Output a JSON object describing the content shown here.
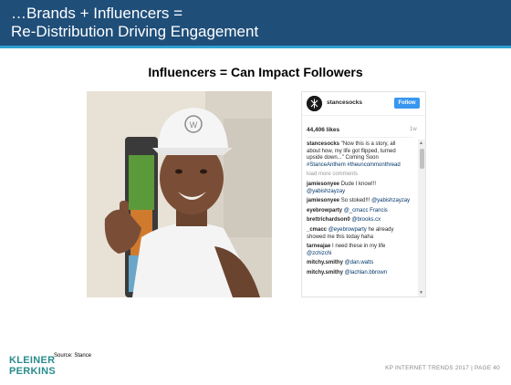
{
  "header": {
    "title_line1": "…Brands + Influencers =",
    "title_line2": "Re-Distribution Driving Engagement",
    "bg_color": "#1f4e79",
    "rule_color": "#2e9fd0"
  },
  "subtitle": "Influencers = Can Impact Followers",
  "post": {
    "username": "stancesocks",
    "follow_label": "Follow",
    "likes": "44,406 likes",
    "time": "1w",
    "caption": {
      "user": "stancesocks",
      "text": "\"Now this is a story, all about how, my life got flipped, turned upside down...\" Coming Soon",
      "tags": "#StanceAnthem #theuncommonthread"
    },
    "load_more": "load more comments",
    "comments": [
      {
        "user": "jamiesonyee",
        "text": "Dude I know!!! ",
        "mention": "@yabishzayzay"
      },
      {
        "user": "jamiesonyee",
        "text": "So stoked!!! ",
        "mention": "@yabishzayzay"
      },
      {
        "user": "eyebrowparty",
        "text": "",
        "mention": "@_cmacc Francis"
      },
      {
        "user": "brettrichardson0",
        "text": "",
        "mention": "@brooks.cx"
      },
      {
        "user": "_cmacc",
        "text": " he already showed me this today haha",
        "mention": "@eyebrowparty"
      },
      {
        "user": "tarneajae",
        "text": "I need these in my life ",
        "mention": "@zchizchi"
      },
      {
        "user": "mitchy.smithy",
        "text": "",
        "mention": "@dan.watts"
      },
      {
        "user": "mitchy.smithy",
        "text": "",
        "mention": "@lachlan.bbrown"
      }
    ],
    "accent_color": "#3897f0"
  },
  "source": "Source: Stance",
  "logo": {
    "line1": "KLEINER",
    "line2": "PERKINS",
    "color": "#2a8c8c"
  },
  "footer": "KP INTERNET TRENDS 2017  |  PAGE 40"
}
